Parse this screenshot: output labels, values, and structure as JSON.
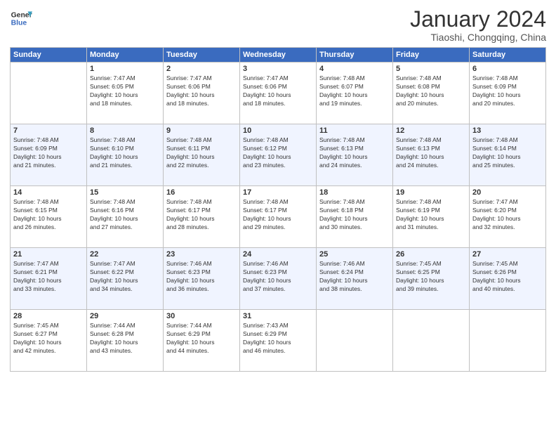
{
  "header": {
    "logo_line1": "General",
    "logo_line2": "Blue",
    "month": "January 2024",
    "location": "Tiaoshi, Chongqing, China"
  },
  "days_of_week": [
    "Sunday",
    "Monday",
    "Tuesday",
    "Wednesday",
    "Thursday",
    "Friday",
    "Saturday"
  ],
  "weeks": [
    [
      {
        "num": "",
        "info": ""
      },
      {
        "num": "1",
        "info": "Sunrise: 7:47 AM\nSunset: 6:05 PM\nDaylight: 10 hours\nand 18 minutes."
      },
      {
        "num": "2",
        "info": "Sunrise: 7:47 AM\nSunset: 6:06 PM\nDaylight: 10 hours\nand 18 minutes."
      },
      {
        "num": "3",
        "info": "Sunrise: 7:47 AM\nSunset: 6:06 PM\nDaylight: 10 hours\nand 18 minutes."
      },
      {
        "num": "4",
        "info": "Sunrise: 7:48 AM\nSunset: 6:07 PM\nDaylight: 10 hours\nand 19 minutes."
      },
      {
        "num": "5",
        "info": "Sunrise: 7:48 AM\nSunset: 6:08 PM\nDaylight: 10 hours\nand 20 minutes."
      },
      {
        "num": "6",
        "info": "Sunrise: 7:48 AM\nSunset: 6:09 PM\nDaylight: 10 hours\nand 20 minutes."
      }
    ],
    [
      {
        "num": "7",
        "info": "Sunrise: 7:48 AM\nSunset: 6:09 PM\nDaylight: 10 hours\nand 21 minutes."
      },
      {
        "num": "8",
        "info": "Sunrise: 7:48 AM\nSunset: 6:10 PM\nDaylight: 10 hours\nand 21 minutes."
      },
      {
        "num": "9",
        "info": "Sunrise: 7:48 AM\nSunset: 6:11 PM\nDaylight: 10 hours\nand 22 minutes."
      },
      {
        "num": "10",
        "info": "Sunrise: 7:48 AM\nSunset: 6:12 PM\nDaylight: 10 hours\nand 23 minutes."
      },
      {
        "num": "11",
        "info": "Sunrise: 7:48 AM\nSunset: 6:13 PM\nDaylight: 10 hours\nand 24 minutes."
      },
      {
        "num": "12",
        "info": "Sunrise: 7:48 AM\nSunset: 6:13 PM\nDaylight: 10 hours\nand 24 minutes."
      },
      {
        "num": "13",
        "info": "Sunrise: 7:48 AM\nSunset: 6:14 PM\nDaylight: 10 hours\nand 25 minutes."
      }
    ],
    [
      {
        "num": "14",
        "info": "Sunrise: 7:48 AM\nSunset: 6:15 PM\nDaylight: 10 hours\nand 26 minutes."
      },
      {
        "num": "15",
        "info": "Sunrise: 7:48 AM\nSunset: 6:16 PM\nDaylight: 10 hours\nand 27 minutes."
      },
      {
        "num": "16",
        "info": "Sunrise: 7:48 AM\nSunset: 6:17 PM\nDaylight: 10 hours\nand 28 minutes."
      },
      {
        "num": "17",
        "info": "Sunrise: 7:48 AM\nSunset: 6:17 PM\nDaylight: 10 hours\nand 29 minutes."
      },
      {
        "num": "18",
        "info": "Sunrise: 7:48 AM\nSunset: 6:18 PM\nDaylight: 10 hours\nand 30 minutes."
      },
      {
        "num": "19",
        "info": "Sunrise: 7:48 AM\nSunset: 6:19 PM\nDaylight: 10 hours\nand 31 minutes."
      },
      {
        "num": "20",
        "info": "Sunrise: 7:47 AM\nSunset: 6:20 PM\nDaylight: 10 hours\nand 32 minutes."
      }
    ],
    [
      {
        "num": "21",
        "info": "Sunrise: 7:47 AM\nSunset: 6:21 PM\nDaylight: 10 hours\nand 33 minutes."
      },
      {
        "num": "22",
        "info": "Sunrise: 7:47 AM\nSunset: 6:22 PM\nDaylight: 10 hours\nand 34 minutes."
      },
      {
        "num": "23",
        "info": "Sunrise: 7:46 AM\nSunset: 6:23 PM\nDaylight: 10 hours\nand 36 minutes."
      },
      {
        "num": "24",
        "info": "Sunrise: 7:46 AM\nSunset: 6:23 PM\nDaylight: 10 hours\nand 37 minutes."
      },
      {
        "num": "25",
        "info": "Sunrise: 7:46 AM\nSunset: 6:24 PM\nDaylight: 10 hours\nand 38 minutes."
      },
      {
        "num": "26",
        "info": "Sunrise: 7:45 AM\nSunset: 6:25 PM\nDaylight: 10 hours\nand 39 minutes."
      },
      {
        "num": "27",
        "info": "Sunrise: 7:45 AM\nSunset: 6:26 PM\nDaylight: 10 hours\nand 40 minutes."
      }
    ],
    [
      {
        "num": "28",
        "info": "Sunrise: 7:45 AM\nSunset: 6:27 PM\nDaylight: 10 hours\nand 42 minutes."
      },
      {
        "num": "29",
        "info": "Sunrise: 7:44 AM\nSunset: 6:28 PM\nDaylight: 10 hours\nand 43 minutes."
      },
      {
        "num": "30",
        "info": "Sunrise: 7:44 AM\nSunset: 6:29 PM\nDaylight: 10 hours\nand 44 minutes."
      },
      {
        "num": "31",
        "info": "Sunrise: 7:43 AM\nSunset: 6:29 PM\nDaylight: 10 hours\nand 46 minutes."
      },
      {
        "num": "",
        "info": ""
      },
      {
        "num": "",
        "info": ""
      },
      {
        "num": "",
        "info": ""
      }
    ]
  ]
}
